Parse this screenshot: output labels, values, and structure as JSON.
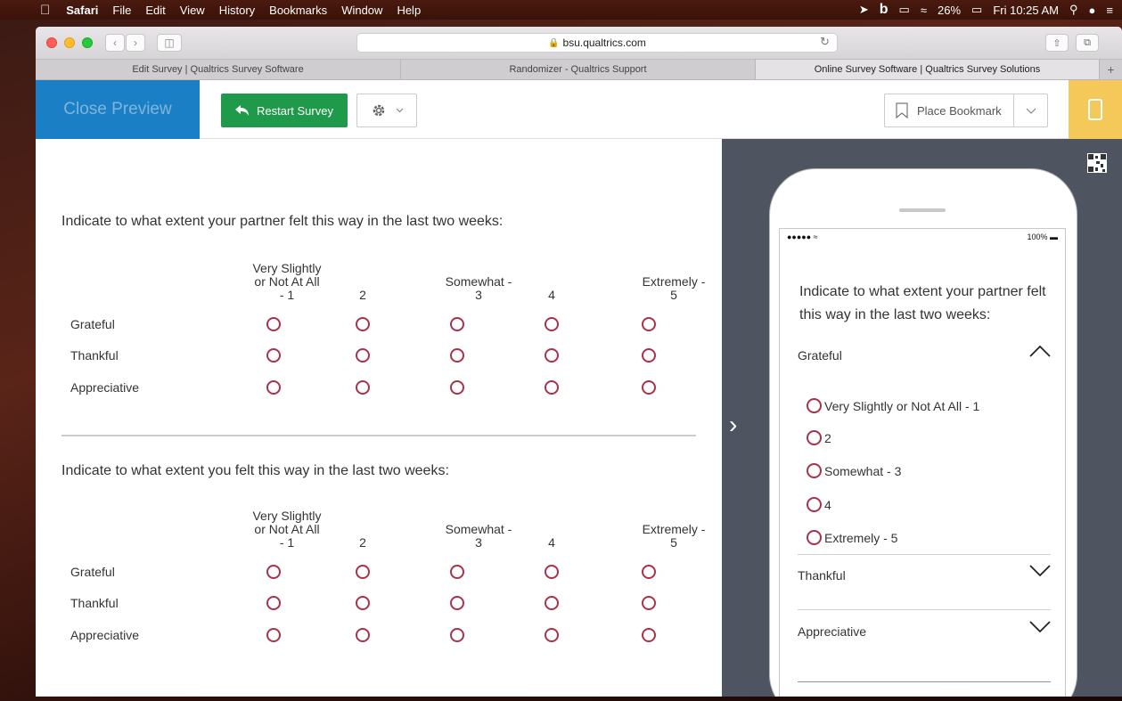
{
  "menubar": {
    "app": "Safari",
    "items": [
      "File",
      "Edit",
      "View",
      "History",
      "Bookmarks",
      "Window",
      "Help"
    ],
    "battery": "26%",
    "clock": "Fri 10:25 AM"
  },
  "browser": {
    "url": "bsu.qualtrics.com",
    "tabs": [
      "Edit Survey | Qualtrics Survey Software",
      "Randomizer - Qualtrics Support",
      "Online Survey Software | Qualtrics Survey Solutions"
    ],
    "new_tab": "+"
  },
  "toolbar": {
    "close_preview": "Close Preview",
    "restart": "Restart Survey",
    "place_bookmark": "Place Bookmark"
  },
  "colors": {
    "accent_blue": "#1a7fc4",
    "restart_green": "#1f9a4a",
    "radio": "#a8324a",
    "mobile_toggle": "#f5c85a",
    "preview_bg": "#4e5560"
  },
  "survey": {
    "columns": [
      "Very Slightly or Not At All - 1",
      "2",
      "Somewhat - 3",
      "4",
      "Extremely - 5"
    ],
    "columns_display": [
      [
        "Very Slightly",
        "or Not At All",
        "- 1"
      ],
      [
        "2"
      ],
      [
        "Somewhat -",
        "3"
      ],
      [
        "4"
      ],
      [
        "Extremely -",
        "5"
      ]
    ],
    "rows": [
      "Grateful",
      "Thankful",
      "Appreciative"
    ],
    "questions": [
      {
        "text": "Indicate to what extent your partner felt this way in the last two weeks:"
      },
      {
        "text": "Indicate to what extent you felt this way in the last two weeks:"
      }
    ]
  },
  "mobile": {
    "battery": "100%",
    "question": "Indicate to what extent your partner felt this way in the last two weeks:",
    "expanded_row": "Grateful",
    "options": [
      "Very Slightly or Not At All - 1",
      "2",
      "Somewhat - 3",
      "4",
      "Extremely - 5"
    ],
    "collapsed_rows": [
      "Thankful",
      "Appreciative"
    ]
  }
}
